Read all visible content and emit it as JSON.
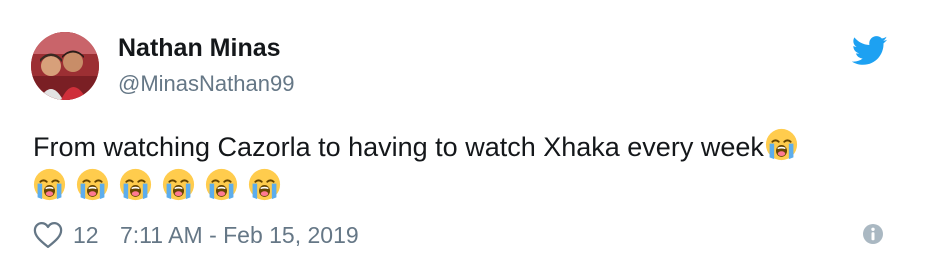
{
  "author": {
    "name": "Nathan Minas",
    "handle": "@MinasNathan99"
  },
  "tweet": {
    "text": "From watching Cazorla to having to watch Xhaka every week",
    "emojis": [
      "loudly-crying-face",
      "loudly-crying-face",
      "loudly-crying-face",
      "loudly-crying-face",
      "loudly-crying-face",
      "loudly-crying-face",
      "loudly-crying-face"
    ]
  },
  "footer": {
    "like_count": "12",
    "timestamp": "7:11 AM - Feb 15, 2019"
  },
  "icons": {
    "brand": "twitter-bird-icon",
    "like": "heart-icon",
    "info": "info-icon"
  },
  "colors": {
    "brand": "#1da1f2",
    "text": "#14171a",
    "secondary": "#657786",
    "emoji_face": "#ffcc4d"
  }
}
